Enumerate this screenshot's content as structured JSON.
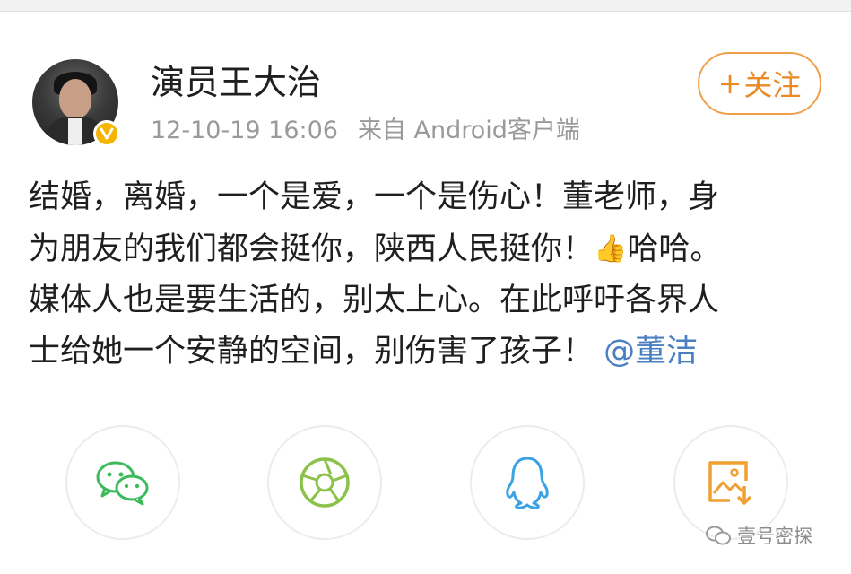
{
  "post": {
    "author": "演员王大治",
    "timestamp": "12-10-19 16:06",
    "source": "来自 Android客户端",
    "follow_label": "关注",
    "follow_plus": "+",
    "lines": {
      "l1": "结婚，离婚，一个是爱，一个是伤心！董老师，身",
      "l2a": "为朋友的我们都会挺你，陕西人民挺你！",
      "l2b": "哈哈。",
      "l3": "媒体人也是要生活的，别太上心。在此呼吁各界人",
      "l4a": "士给她一个安静的空间，别伤害了孩子！",
      "mention": "@董洁"
    },
    "emoji_thumb": "👍"
  },
  "share": {
    "items": [
      "wechat-icon",
      "moments-icon",
      "qq-icon",
      "save-image-icon"
    ]
  },
  "watermark": {
    "text": "壹号密探"
  },
  "colors": {
    "accent_orange": "#ea8a22",
    "mention_blue": "#4a7fc1",
    "wechat_green": "#3dbb5a",
    "moments_green": "#8bc34a",
    "qq_blue": "#3aa3e3",
    "save_orange": "#f0a030",
    "verified_gold": "#f5b400"
  }
}
